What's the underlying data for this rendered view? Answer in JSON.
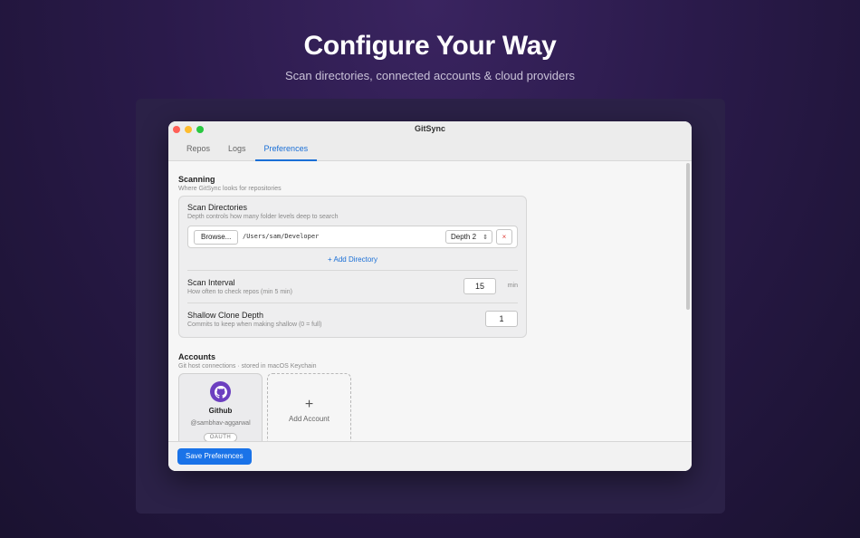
{
  "hero": {
    "title": "Configure Your Way",
    "subtitle": "Scan directories, connected accounts & cloud providers"
  },
  "window": {
    "title": "GitSync",
    "tabs": [
      {
        "label": "Repos",
        "active": false
      },
      {
        "label": "Logs",
        "active": false
      },
      {
        "label": "Preferences",
        "active": true
      }
    ]
  },
  "scanning": {
    "title": "Scanning",
    "subtitle": "Where GitSync looks for repositories",
    "scan_directories": {
      "title": "Scan Directories",
      "subtitle": "Depth controls how many folder levels deep to search",
      "browse_label": "Browse...",
      "path": "/Users/sam/Developer",
      "depth_value": "Depth 2",
      "remove_label": "×",
      "add_label": "+ Add Directory"
    },
    "scan_interval": {
      "title": "Scan Interval",
      "subtitle": "How often to check repos (min 5 min)",
      "value": "15",
      "unit": "min"
    },
    "shallow_clone": {
      "title": "Shallow Clone Depth",
      "subtitle": "Commits to keep when making shallow (0 = full)",
      "value": "1"
    }
  },
  "accounts": {
    "title": "Accounts",
    "subtitle": "Git host connections · stored in macOS Keychain",
    "items": [
      {
        "provider": "Github",
        "handle": "@sambhav-aggarwal",
        "auth": "OAUTH",
        "icon": "github-icon"
      }
    ],
    "add_label": "Add Account",
    "add_symbol": "+"
  },
  "footer": {
    "save_label": "Save Preferences"
  },
  "colors": {
    "accent": "#1a73e8",
    "github_purple": "#6c3fc0",
    "remove_red": "#e0443e"
  }
}
